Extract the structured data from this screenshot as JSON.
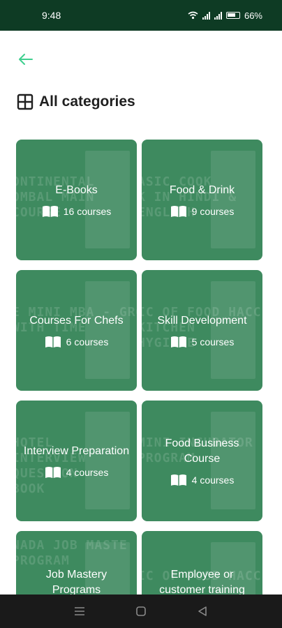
{
  "status_bar": {
    "time": "9:48",
    "battery": "66%",
    "icons": [
      "wifi-icon",
      "signal-icon",
      "signal-icon",
      "battery-icon"
    ]
  },
  "header": {
    "back_icon": "arrow-left-icon",
    "title": "All categories",
    "title_icon": "grid-icon"
  },
  "colors": {
    "status_bar": "#0e3b24",
    "card": "#3e8a5f",
    "accent": "#3ecf8e"
  },
  "categories": [
    {
      "title": "E-Books",
      "count": "16 courses",
      "icon": "book-icon"
    },
    {
      "title": "Food & Drink",
      "count": "9 courses",
      "icon": "book-icon"
    },
    {
      "title": "Courses For Chefs",
      "count": "6 courses",
      "icon": "book-icon"
    },
    {
      "title": "Skill Development",
      "count": "5 courses",
      "icon": "book-icon"
    },
    {
      "title": "Interview Preparation",
      "count": "4 courses",
      "icon": "book-icon"
    },
    {
      "title": "Food Business Course",
      "count": "4 courses",
      "icon": "book-icon"
    },
    {
      "title": "Job Mastery Programs",
      "count": "",
      "icon": "book-icon"
    },
    {
      "title": "Employee or customer training",
      "count": "",
      "icon": "book-icon"
    }
  ],
  "nav_bar": {
    "icons": [
      "menu-icon",
      "home-icon",
      "back-icon"
    ]
  }
}
